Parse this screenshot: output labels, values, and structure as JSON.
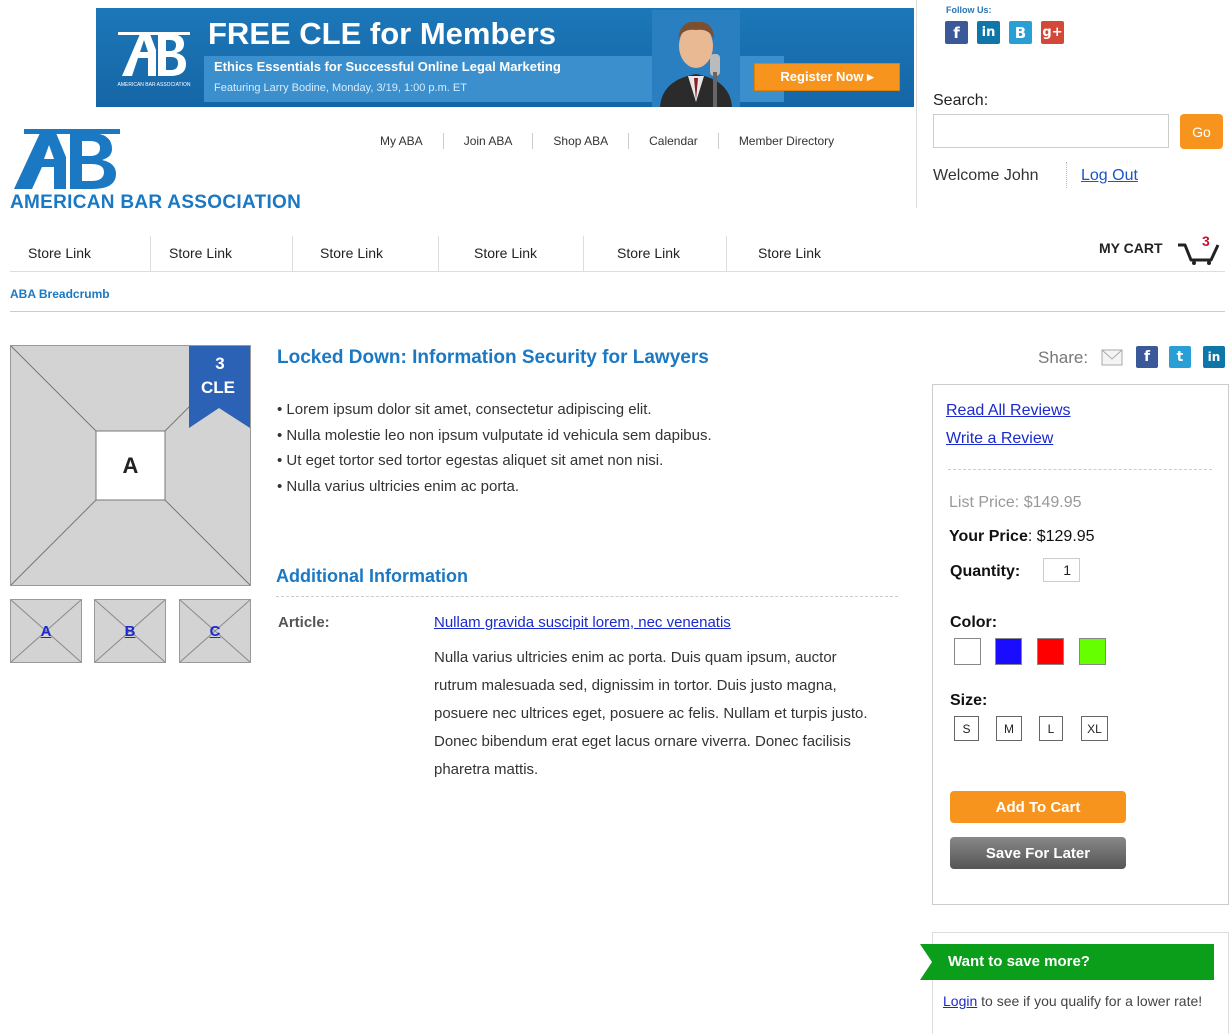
{
  "banner": {
    "headline": "FREE CLE for Members",
    "subline1": "Ethics Essentials for Successful Online Legal Marketing",
    "subline2": "Featuring Larry Bodine, Monday, 3/19, 1:00 p.m. ET",
    "register_label": "Register Now ▸",
    "logo_caption": "AMERICAN BAR ASSOCIATION"
  },
  "follow": {
    "label": "Follow Us:",
    "icons": [
      "facebook-icon",
      "linkedin-icon",
      "blogger-icon",
      "google-plus-icon"
    ]
  },
  "search": {
    "label": "Search:",
    "placeholder": "",
    "go_label": "Go"
  },
  "account": {
    "welcome": "Welcome John",
    "logout": "Log Out"
  },
  "brand": {
    "org_name": "AMERICAN BAR ASSOCIATION",
    "color": "#1b78c3"
  },
  "top_nav": [
    "My ABA",
    "Join ABA",
    "Shop ABA",
    "Calendar",
    "Member Directory"
  ],
  "store_nav": [
    "Store Link",
    "Store Link",
    "Store Link",
    "Store Link",
    "Store Link",
    "Store Link"
  ],
  "cart": {
    "label": "MY CART",
    "count": "3"
  },
  "breadcrumb": "ABA Breadcrumb",
  "product": {
    "image_label": "A",
    "cle_number": "3",
    "cle_label": "CLE",
    "thumbs": [
      "A",
      "B",
      "C"
    ],
    "title": "Locked Down: Information Security for Lawyers",
    "bullets": [
      "• Lorem ipsum dolor sit amet, consectetur adipiscing elit.",
      "• Nulla molestie leo non ipsum vulputate id vehicula sem dapibus.",
      "• Ut eget tortor sed tortor egestas aliquet sit amet non nisi.",
      "• Nulla varius ultricies enim ac porta."
    ],
    "additional_title": "Additional Information",
    "article_label": "Article:",
    "article_link": "Nullam gravida suscipit lorem, nec venenatis",
    "article_desc": "Nulla varius ultricies enim ac porta. Duis quam ipsum, auctor rutrum malesuada sed, dignissim in tortor. Duis justo magna, posuere nec ultrices eget, posuere ac felis. Nullam et turpis justo. Donec bibendum erat eget lacus ornare viverra. Donec facilisis pharetra mattis."
  },
  "share": {
    "label": "Share:",
    "icons": [
      "email-icon",
      "facebook-icon",
      "twitter-icon",
      "linkedin-icon"
    ]
  },
  "purchase": {
    "read_reviews": "Read All Reviews",
    "write_review": "Write a Review",
    "list_price_label": "List Price:",
    "list_price": "$149.95",
    "your_price_label": "Your Price",
    "your_price": ": $129.95",
    "quantity_label": "Quantity:",
    "quantity": "1",
    "color_label": "Color:",
    "colors": [
      "#ffffff",
      "#1a0dff",
      "#ff0000",
      "#66ff00"
    ],
    "size_label": "Size:",
    "sizes": [
      "S",
      "M",
      "L",
      "XL"
    ],
    "add_to_cart": "Add To Cart",
    "save_for_later": "Save For Later"
  },
  "save_more": {
    "title": "Want to save more?",
    "login": "Login",
    "body": " to see if you qualify for a lower rate!"
  }
}
